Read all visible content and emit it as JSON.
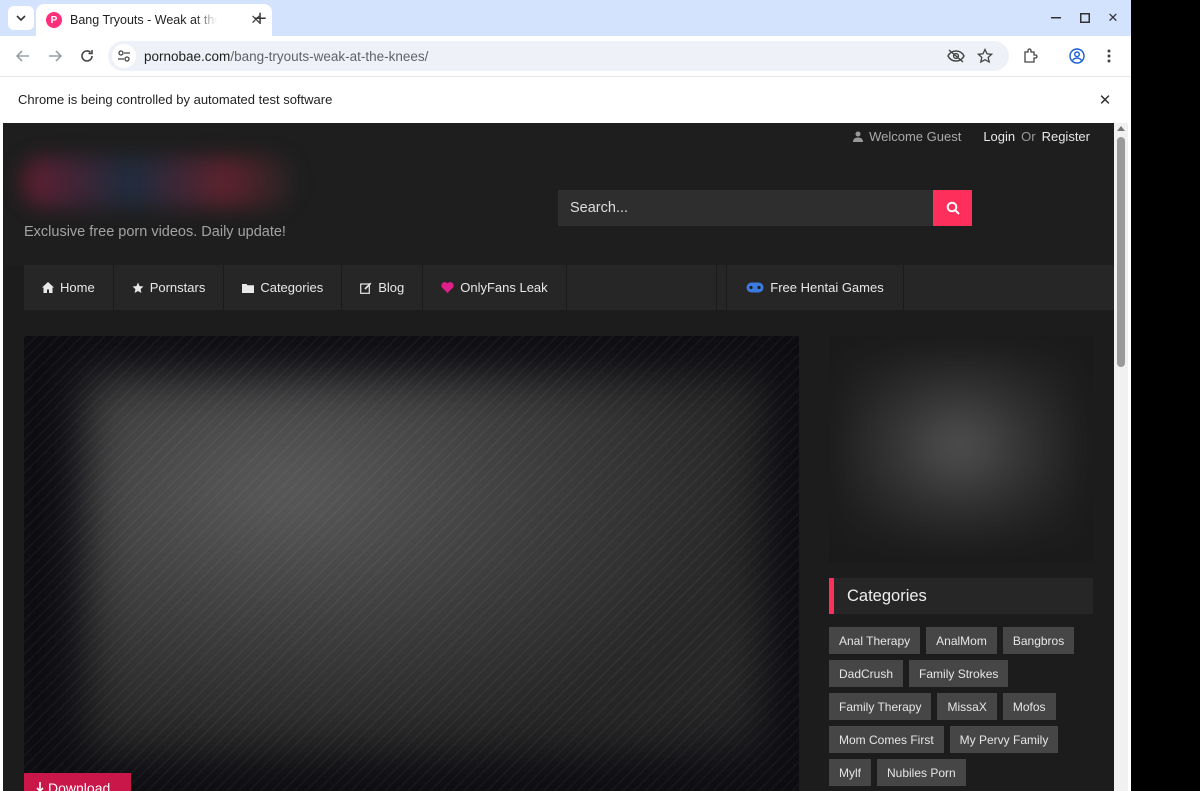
{
  "browser": {
    "tab_title": "Bang Tryouts - Weak at the Knees",
    "tab_favicon_letter": "P",
    "url_domain": "pornobae.com",
    "url_path": "/bang-tryouts-weak-at-the-knees/",
    "infobar_text": "Chrome is being controlled by automated test software"
  },
  "site": {
    "userbar": {
      "welcome": "Welcome Guest",
      "login": "Login",
      "or": "Or",
      "register": "Register"
    },
    "tagline": "Exclusive free porn videos. Daily update!",
    "search_placeholder": "Search...",
    "nav": {
      "home": "Home",
      "pornstars": "Pornstars",
      "categories": "Categories",
      "blog": "Blog",
      "onlyfans": "OnlyFans Leak",
      "hentai": "Free Hentai Games"
    },
    "download_label": "Download",
    "categories_title": "Categories",
    "categories": [
      "Anal Therapy",
      "AnalMom",
      "Bangbros",
      "DadCrush",
      "Family Strokes",
      "Family Therapy",
      "MissaX",
      "Mofos",
      "Mom Comes First",
      "My Pervy Family",
      "Mylf",
      "Nubiles Porn"
    ],
    "accent_color": "#ff2f5b"
  }
}
